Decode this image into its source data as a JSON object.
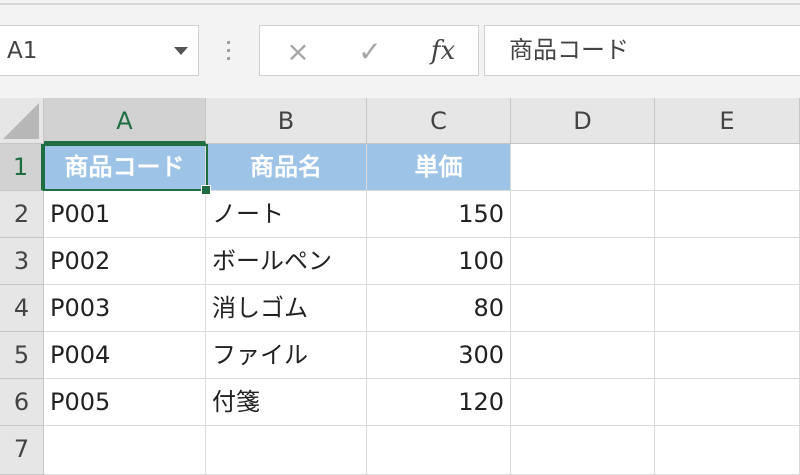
{
  "name_box": {
    "value": "A1"
  },
  "formula_bar": {
    "cancel_icon": "×",
    "enter_icon": "✓",
    "fx_label": "fx",
    "value": "商品コード"
  },
  "columns": [
    "A",
    "B",
    "C",
    "D",
    "E"
  ],
  "rows": [
    "1",
    "2",
    "3",
    "4",
    "5",
    "6",
    "7"
  ],
  "table": {
    "headers": [
      "商品コード",
      "商品名",
      "単価"
    ],
    "data": [
      [
        "P001",
        "ノート",
        "150"
      ],
      [
        "P002",
        "ボールペン",
        "100"
      ],
      [
        "P003",
        "消しゴム",
        "80"
      ],
      [
        "P004",
        "ファイル",
        "300"
      ],
      [
        "P005",
        "付箋",
        "120"
      ]
    ]
  },
  "selection": {
    "active_cell": "A1"
  },
  "colors": {
    "header_fill": "#9dc3e6",
    "header_text": "#ffffff",
    "selection": "#1f6e43"
  }
}
